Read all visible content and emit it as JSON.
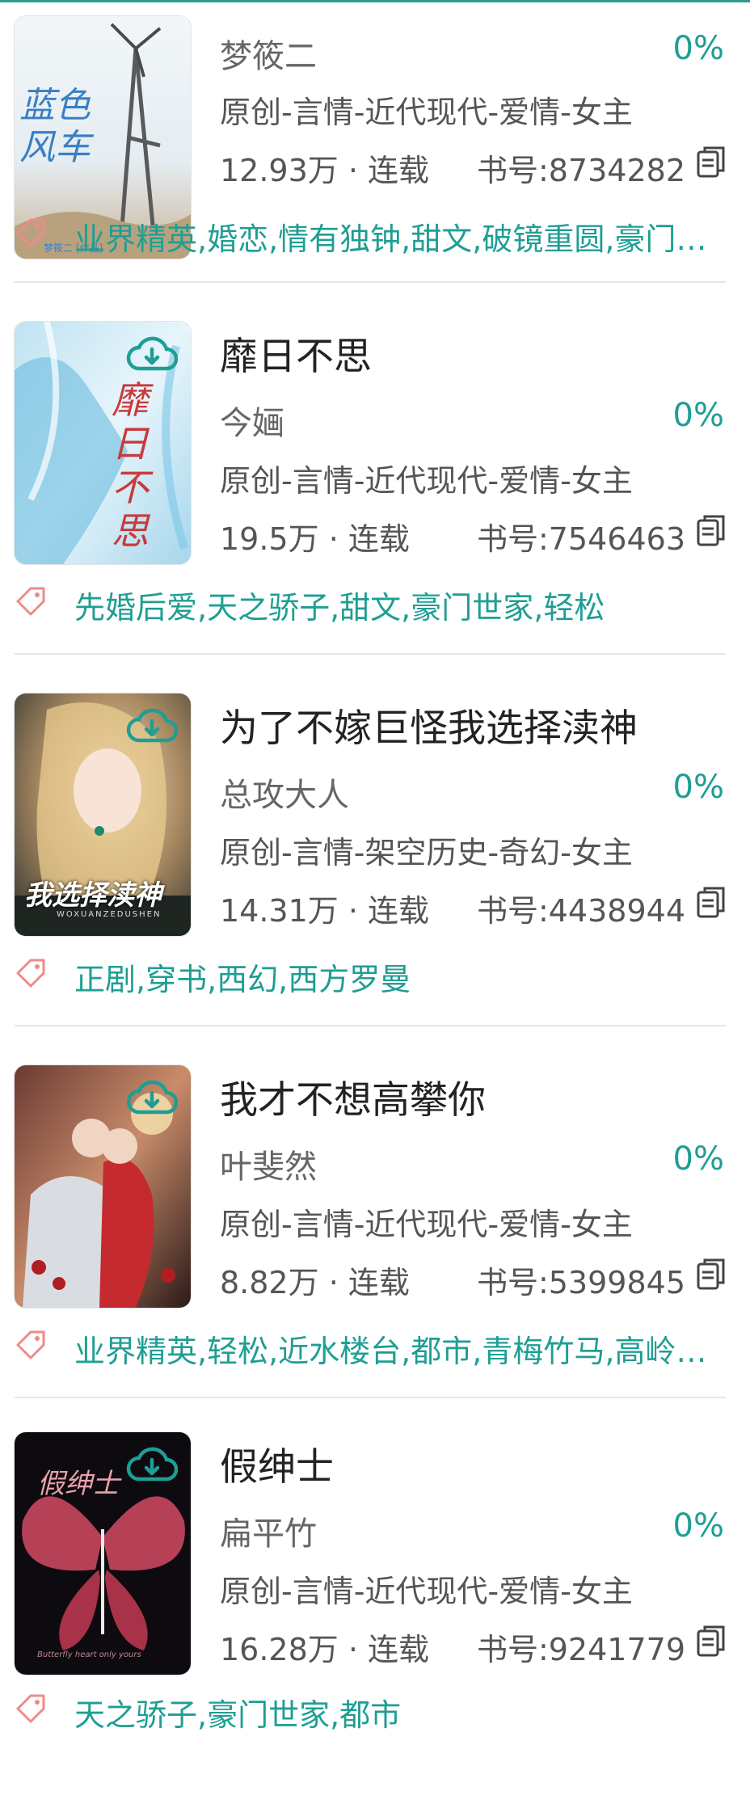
{
  "accent_color": "#1f9e93",
  "books": [
    {
      "title": "",
      "author": "梦筱二",
      "progress": "0%",
      "category": "原创-言情-近代现代-爱情-女主",
      "words": "12.93万 · 连载",
      "book_id": "书号:8734282",
      "tags": "业界精英,婚恋,情有独钟,甜文,破镜重圆,豪门…",
      "cover_text": "蓝色风车",
      "cover_subtext": "梦筱二 [作品]"
    },
    {
      "title": "靡日不思",
      "author": "今婳",
      "progress": "0%",
      "category": "原创-言情-近代现代-爱情-女主",
      "words": "19.5万 · 连载",
      "book_id": "书号:7546463",
      "tags": "先婚后爱,天之骄子,甜文,豪门世家,轻松",
      "cover_text": "靡日不思",
      "cover_subtext": ""
    },
    {
      "title": "为了不嫁巨怪我选择渎神",
      "author": "总攻大人",
      "progress": "0%",
      "category": "原创-言情-架空历史-奇幻-女主",
      "words": "14.31万 · 连载",
      "book_id": "书号:4438944",
      "tags": "正剧,穿书,西幻,西方罗曼",
      "cover_text": "我选择渎神",
      "cover_subtext": "WOXUANZEDUSHEN"
    },
    {
      "title": "我才不想高攀你",
      "author": "叶斐然",
      "progress": "0%",
      "category": "原创-言情-近代现代-爱情-女主",
      "words": "8.82万 · 连载",
      "book_id": "书号:5399845",
      "tags": "业界精英,轻松,近水楼台,都市,青梅竹马,高岭…",
      "cover_text": "",
      "cover_subtext": ""
    },
    {
      "title": "假绅士",
      "author": "扁平竹",
      "progress": "0%",
      "category": "原创-言情-近代现代-爱情-女主",
      "words": "16.28万 · 连载",
      "book_id": "书号:9241779",
      "tags": "天之骄子,豪门世家,都市",
      "cover_text": "假绅士",
      "cover_subtext": "Butterfly heart only yours"
    }
  ]
}
